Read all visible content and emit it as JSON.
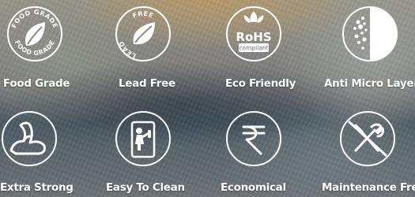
{
  "features": [
    {
      "label": "Food Grade",
      "icon": "food-grade-icon",
      "badge_text_top": "FOOD GRADE",
      "badge_text_bottom": "FOOD GRADE"
    },
    {
      "label": "Lead Free",
      "icon": "lead-free-icon",
      "badge_text_top": "FREE",
      "badge_text_left": "LEAD"
    },
    {
      "label": "Eco Friendly",
      "icon": "rohs-compliant-icon",
      "badge_text_main": "RoHS",
      "badge_text_sub": "compliant"
    },
    {
      "label": "Anti Micro Layer",
      "icon": "anti-microbial-icon"
    },
    {
      "label": "Extra Strong",
      "icon": "flexed-arm-icon"
    },
    {
      "label": "Easy To Clean",
      "icon": "person-cleaning-icon"
    },
    {
      "label": "Economical",
      "icon": "rupee-icon"
    },
    {
      "label": "Maintenance Free",
      "icon": "no-tools-icon"
    }
  ],
  "colors": {
    "icon": "#ffffff",
    "label": "#ffffff"
  }
}
